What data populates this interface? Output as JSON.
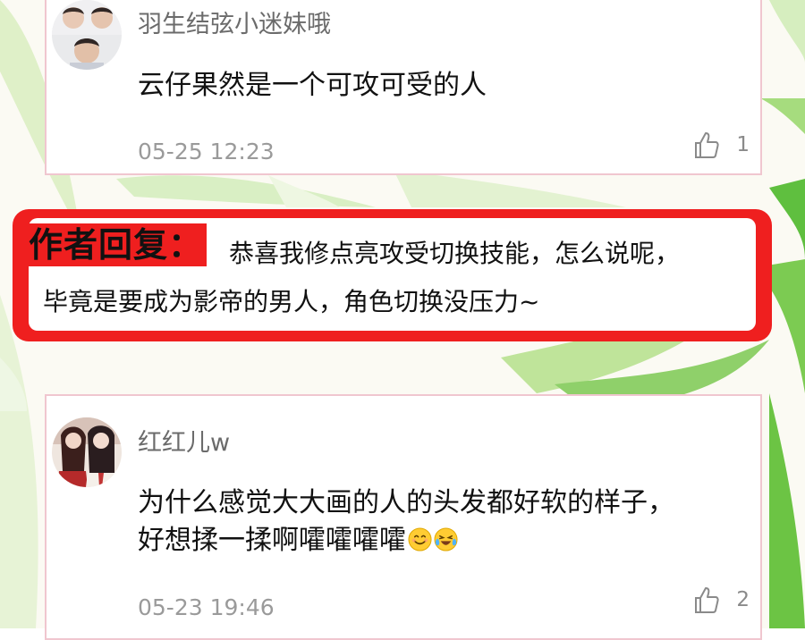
{
  "comments": [
    {
      "username": "羽生结弦小迷妹哦",
      "text": "云仔果然是一个可攻可受的人",
      "timestamp": "05-25 12:23",
      "likes": "1"
    },
    {
      "username": "红红儿w",
      "text_line1": "为什么感觉大大画的人的头发都好软的样子，",
      "text_line2": "好想揉一揉啊嚯嚯嚯嚯",
      "emojis": [
        "smiling-face-icon",
        "tears-of-joy-icon"
      ],
      "timestamp": "05-23 19:46",
      "likes": "2"
    }
  ],
  "author_reply": {
    "tag": "作者回复：",
    "line1": "恭喜我修点亮攻受切换技能，怎么说呢，",
    "line2": "毕竟是要成为影帝的男人，角色切换没压力~"
  },
  "colors": {
    "reply_frame": "#ef1f1f",
    "card_border": "#f0c6cf",
    "background_leaf": "#8fd06a"
  }
}
